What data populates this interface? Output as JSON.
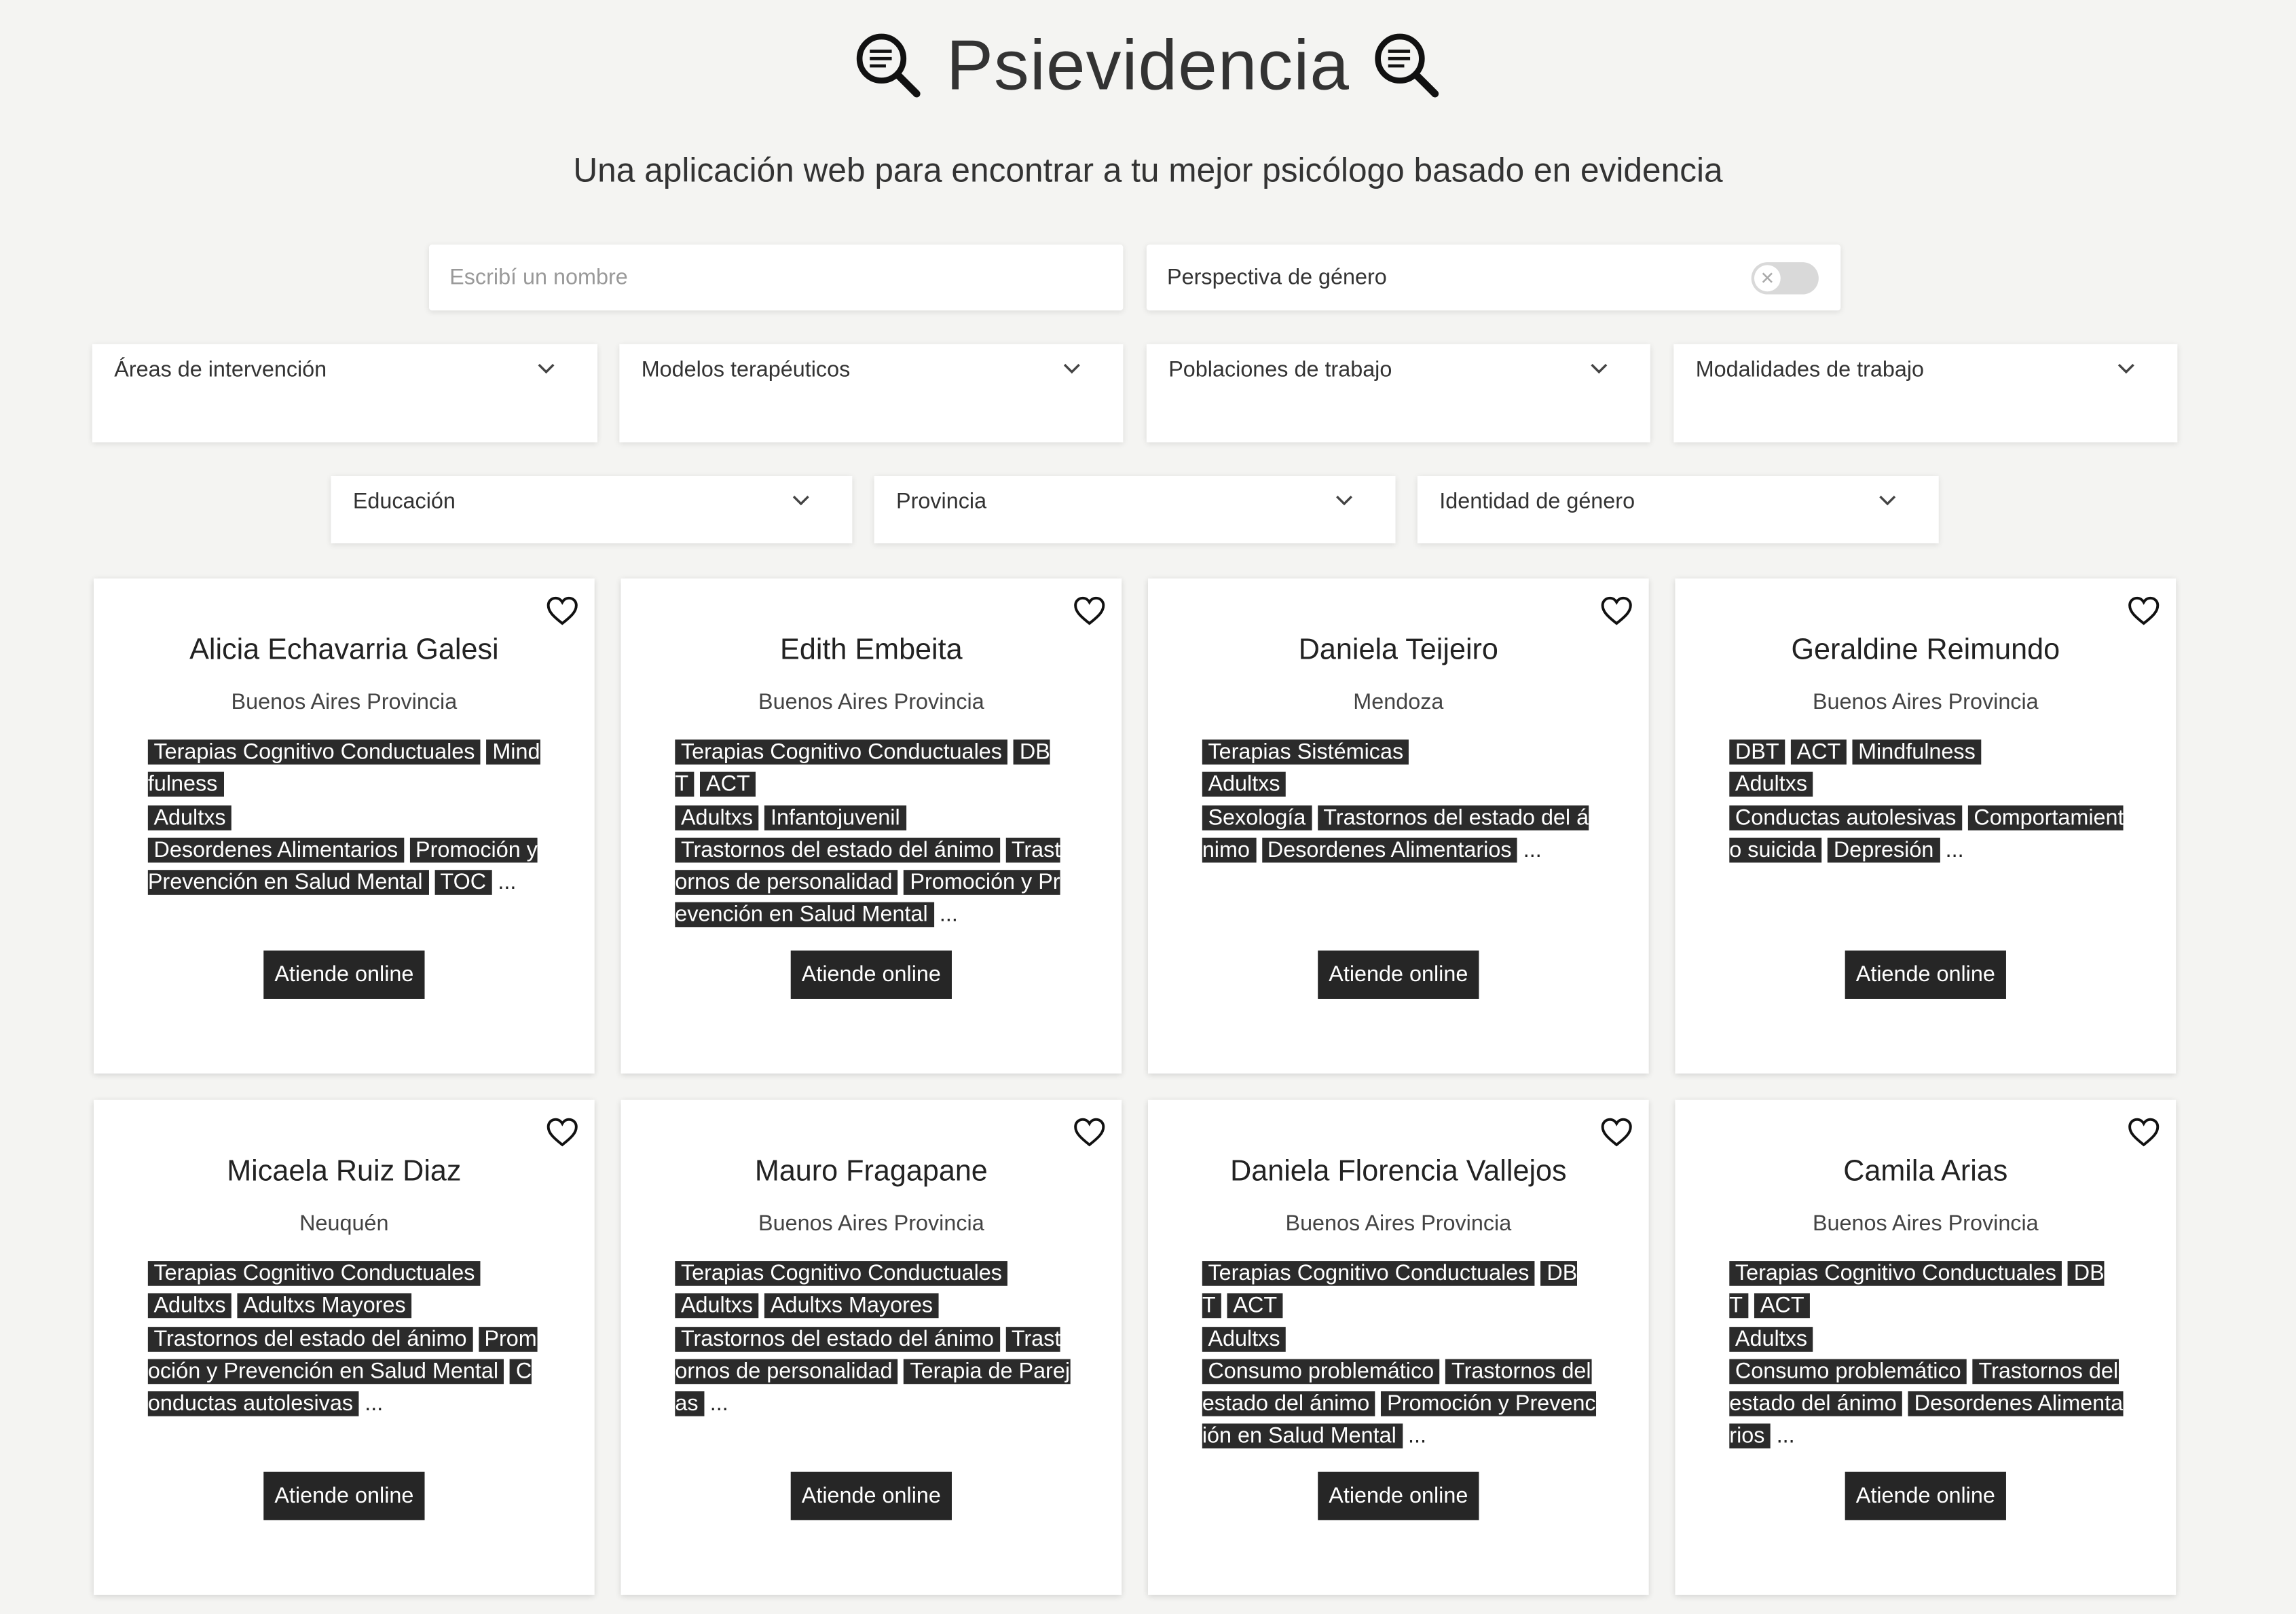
{
  "header": {
    "title": "Psievidencia",
    "subtitle": "Una aplicación web para encontrar a tu mejor psicólogo basado en evidencia"
  },
  "search": {
    "placeholder": "Escribí un nombre",
    "value": ""
  },
  "gender_toggle": {
    "label": "Perspectiva de género",
    "state": "off"
  },
  "filters": {
    "areas": "Áreas de intervención",
    "modelos": "Modelos terapéuticos",
    "poblaciones": "Poblaciones de trabajo",
    "modalidades": "Modalidades de trabajo",
    "educacion": "Educación",
    "provincia": "Provincia",
    "identidad": "Identidad de género"
  },
  "cards": [
    {
      "name": "Alicia Echavarria Galesi",
      "location": "Buenos Aires Provincia",
      "button": "Atiende online",
      "groups": [
        [
          "Terapias Cognitivo Conductuales",
          "Mindfulness"
        ],
        [
          "Adultxs"
        ],
        [
          "Desordenes Alimentarios",
          "Promoción y Prevención en Salud Mental",
          "TOC"
        ]
      ]
    },
    {
      "name": "Edith Embeita",
      "location": "Buenos Aires Provincia",
      "button": "Atiende online",
      "groups": [
        [
          "Terapias Cognitivo Conductuales",
          "DBT",
          "ACT"
        ],
        [
          "Adultxs",
          "Infantojuvenil"
        ],
        [
          "Trastornos del estado del ánimo",
          "Trastornos de personalidad",
          "Promoción y Prevención en Salud Mental"
        ]
      ]
    },
    {
      "name": "Daniela Teijeiro",
      "location": "Mendoza",
      "button": "Atiende online",
      "groups": [
        [
          "Terapias Sistémicas"
        ],
        [
          "Adultxs"
        ],
        [
          "Sexología",
          "Trastornos del estado del ánimo",
          "Desordenes Alimentarios"
        ]
      ]
    },
    {
      "name": "Geraldine Reimundo",
      "location": "Buenos Aires Provincia",
      "button": "Atiende online",
      "groups": [
        [
          "DBT",
          "ACT",
          "Mindfulness"
        ],
        [
          "Adultxs"
        ],
        [
          "Conductas autolesivas",
          "Comportamiento suicida",
          "Depresión"
        ]
      ]
    },
    {
      "name": "Micaela Ruiz Diaz",
      "location": "Neuquén",
      "button": "Atiende online",
      "groups": [
        [
          "Terapias Cognitivo Conductuales"
        ],
        [
          "Adultxs",
          "Adultxs Mayores"
        ],
        [
          "Trastornos del estado del ánimo",
          "Promoción y Prevención en Salud Mental",
          "Conductas autolesivas"
        ]
      ]
    },
    {
      "name": "Mauro Fragapane",
      "location": "Buenos Aires Provincia",
      "button": "Atiende online",
      "groups": [
        [
          "Terapias Cognitivo Conductuales"
        ],
        [
          "Adultxs",
          "Adultxs Mayores"
        ],
        [
          "Trastornos del estado del ánimo",
          "Trastornos de personalidad",
          "Terapia de Parejas"
        ]
      ]
    },
    {
      "name": "Daniela Florencia Vallejos",
      "location": "Buenos Aires Provincia",
      "button": "Atiende online",
      "groups": [
        [
          "Terapias Cognitivo Conductuales",
          "DBT",
          "ACT"
        ],
        [
          "Adultxs"
        ],
        [
          "Consumo problemático",
          "Trastornos del estado del ánimo",
          "Promoción y Prevención en Salud Mental"
        ]
      ]
    },
    {
      "name": "Camila Arias",
      "location": "Buenos Aires Provincia",
      "button": "Atiende online",
      "groups": [
        [
          "Terapias Cognitivo Conductuales",
          "DBT",
          "ACT"
        ],
        [
          "Adultxs"
        ],
        [
          "Consumo problemático",
          "Trastornos del estado del ánimo",
          "Desordenes Alimentarios"
        ]
      ]
    }
  ],
  "ellipsis": "..."
}
